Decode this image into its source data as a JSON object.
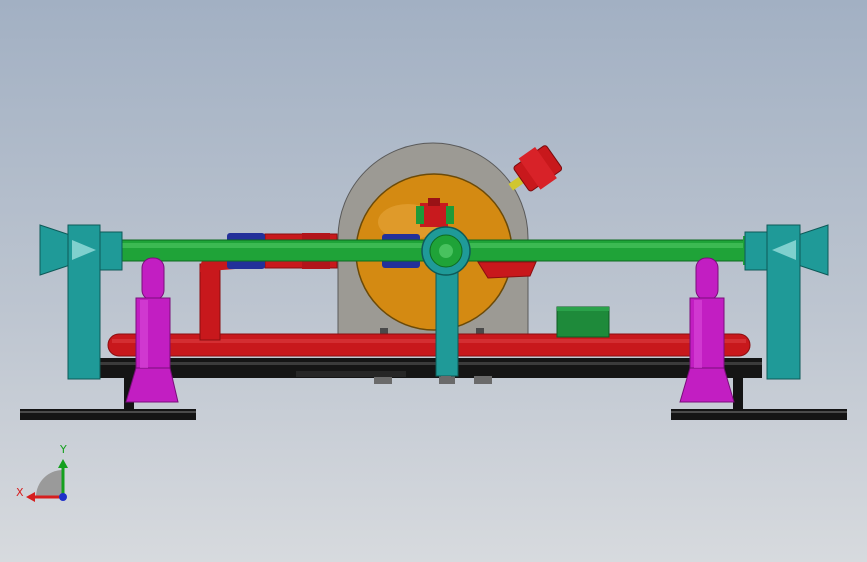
{
  "viewport": {
    "background_top": "#a2b0c3",
    "background_bottom": "#d7dade"
  },
  "triad": {
    "x_label": "X",
    "y_label": "Y",
    "x_color": "#d61e1e",
    "y_color": "#14a01e",
    "z_color": "#1e2fc8"
  },
  "colors": {
    "green_pipe": "#1fa338",
    "red_pipe": "#c8181c",
    "teal_frame": "#1f9a98",
    "magenta_leg": "#c21ec2",
    "orange_tank": "#d48a12",
    "gray_cradle": "#9c9a94",
    "navy_fitting": "#23309a",
    "base_plate": "#141414",
    "green_box": "#1e8a3a"
  }
}
